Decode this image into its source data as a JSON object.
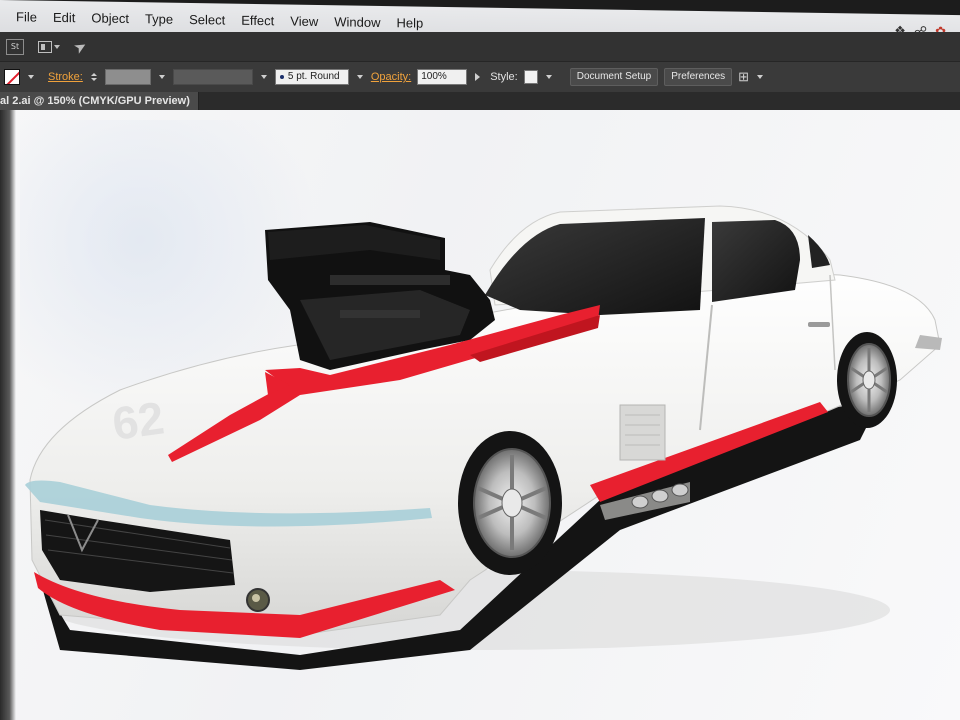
{
  "menubar": {
    "items": [
      "File",
      "Edit",
      "Object",
      "Type",
      "Select",
      "Effect",
      "View",
      "Window",
      "Help"
    ]
  },
  "appbar": {
    "logo_text": "St"
  },
  "controlbar": {
    "stroke_label": "Stroke:",
    "brush_value": "5 pt. Round",
    "opacity_label": "Opacity:",
    "opacity_value": "100%",
    "style_label": "Style:",
    "document_setup_label": "Document Setup",
    "preferences_label": "Preferences"
  },
  "document": {
    "tab_title": "al 2.ai @ 150% (CMYK/GPU Preview)"
  },
  "colors": {
    "menubar_bg": "#e3e4e6",
    "toolbar_bg": "#3a3a3a",
    "stroke_label": "#f0a23c",
    "stripe_red": "#e8202f",
    "car_body": "#f4f4f2"
  },
  "icons": {
    "app_logo": "stock-logo-icon",
    "workspace": "workspace-switcher-icon",
    "brush": "brush-icon",
    "arrange": "arrange-documents-icon",
    "creative_cloud": "creative-cloud-icon"
  }
}
